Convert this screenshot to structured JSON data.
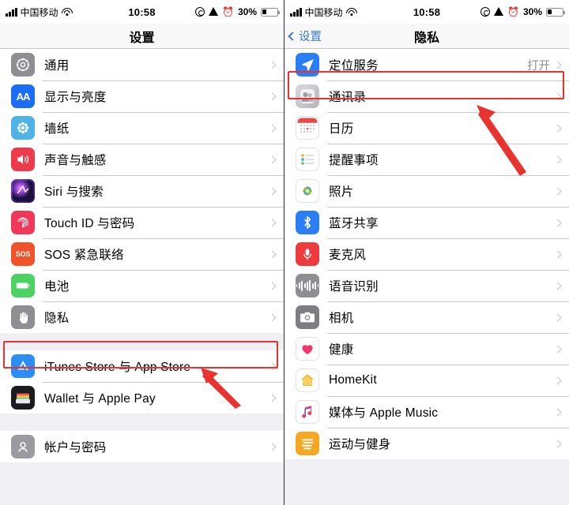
{
  "status_bar": {
    "carrier": "中国移动",
    "time": "10:58",
    "battery_percent": "30%",
    "icons": [
      "signal-icon",
      "wifi-icon",
      "rotation-lock-icon",
      "location-arrow-icon",
      "alarm-clock-icon",
      "battery-icon"
    ]
  },
  "left_panel": {
    "title": "设置",
    "groups": [
      {
        "rows": [
          {
            "label": "通用",
            "icon": "gear-icon",
            "icon_class": "ic-gear",
            "value": ""
          },
          {
            "label": "显示与亮度",
            "icon": "text-size-icon",
            "icon_class": "ic-aa",
            "value": ""
          },
          {
            "label": "墙纸",
            "icon": "wallpaper-icon",
            "icon_class": "ic-wall",
            "value": ""
          },
          {
            "label": "声音与触感",
            "icon": "speaker-icon",
            "icon_class": "ic-sound",
            "value": ""
          },
          {
            "label": "Siri 与搜索",
            "icon": "siri-icon",
            "icon_class": "ic-siri",
            "value": ""
          },
          {
            "label": "Touch ID 与密码",
            "icon": "fingerprint-icon",
            "icon_class": "ic-touch",
            "value": ""
          },
          {
            "label": "SOS 紧急联络",
            "icon": "sos-icon",
            "icon_class": "ic-sos",
            "value": ""
          },
          {
            "label": "电池",
            "icon": "battery-icon",
            "icon_class": "ic-batt",
            "value": ""
          },
          {
            "label": "隐私",
            "icon": "hand-icon",
            "icon_class": "ic-priv",
            "value": "",
            "highlighted": true
          }
        ]
      },
      {
        "rows": [
          {
            "label": "iTunes Store 与 App Store",
            "icon": "app-store-icon",
            "icon_class": "ic-appstore",
            "value": ""
          },
          {
            "label": "Wallet 与 Apple Pay",
            "icon": "wallet-icon",
            "icon_class": "ic-wallet",
            "value": ""
          }
        ]
      },
      {
        "rows": [
          {
            "label": "帐户与密码",
            "icon": "key-icon",
            "icon_class": "ic-account",
            "value": ""
          }
        ]
      }
    ]
  },
  "right_panel": {
    "back_label": "设置",
    "title": "隐私",
    "groups": [
      {
        "rows": [
          {
            "label": "定位服务",
            "icon": "location-arrow-icon",
            "icon_class": "ic-loc",
            "value": "打开",
            "highlighted": true
          },
          {
            "label": "通讯录",
            "icon": "contacts-icon",
            "icon_class": "ic-contacts",
            "value": ""
          },
          {
            "label": "日历",
            "icon": "calendar-icon",
            "icon_class": "ic-cal",
            "value": ""
          },
          {
            "label": "提醒事项",
            "icon": "reminders-icon",
            "icon_class": "ic-remind",
            "value": ""
          },
          {
            "label": "照片",
            "icon": "photos-icon",
            "icon_class": "ic-photos",
            "value": ""
          },
          {
            "label": "蓝牙共享",
            "icon": "bluetooth-icon",
            "icon_class": "ic-bt",
            "value": ""
          },
          {
            "label": "麦克风",
            "icon": "microphone-icon",
            "icon_class": "ic-mic",
            "value": ""
          },
          {
            "label": "语音识别",
            "icon": "waveform-icon",
            "icon_class": "ic-voice",
            "value": ""
          },
          {
            "label": "相机",
            "icon": "camera-icon",
            "icon_class": "ic-cam",
            "value": ""
          },
          {
            "label": "健康",
            "icon": "heart-icon",
            "icon_class": "ic-health",
            "value": ""
          },
          {
            "label": "HomeKit",
            "icon": "house-icon",
            "icon_class": "ic-home",
            "value": ""
          },
          {
            "label": "媒体与 Apple Music",
            "icon": "music-note-icon",
            "icon_class": "ic-music",
            "value": ""
          },
          {
            "label": "运动与健身",
            "icon": "fitness-icon",
            "icon_class": "ic-fit",
            "value": ""
          }
        ]
      }
    ]
  },
  "annotations": {
    "highlight_color": "#e8332f",
    "boxes": [
      {
        "name": "privacy-row-highlight",
        "panel": "left"
      },
      {
        "name": "location-services-row-highlight",
        "panel": "right"
      }
    ],
    "arrows": [
      {
        "name": "privacy-pointer-arrow",
        "panel": "left"
      },
      {
        "name": "location-services-pointer-arrow",
        "panel": "right"
      }
    ]
  }
}
